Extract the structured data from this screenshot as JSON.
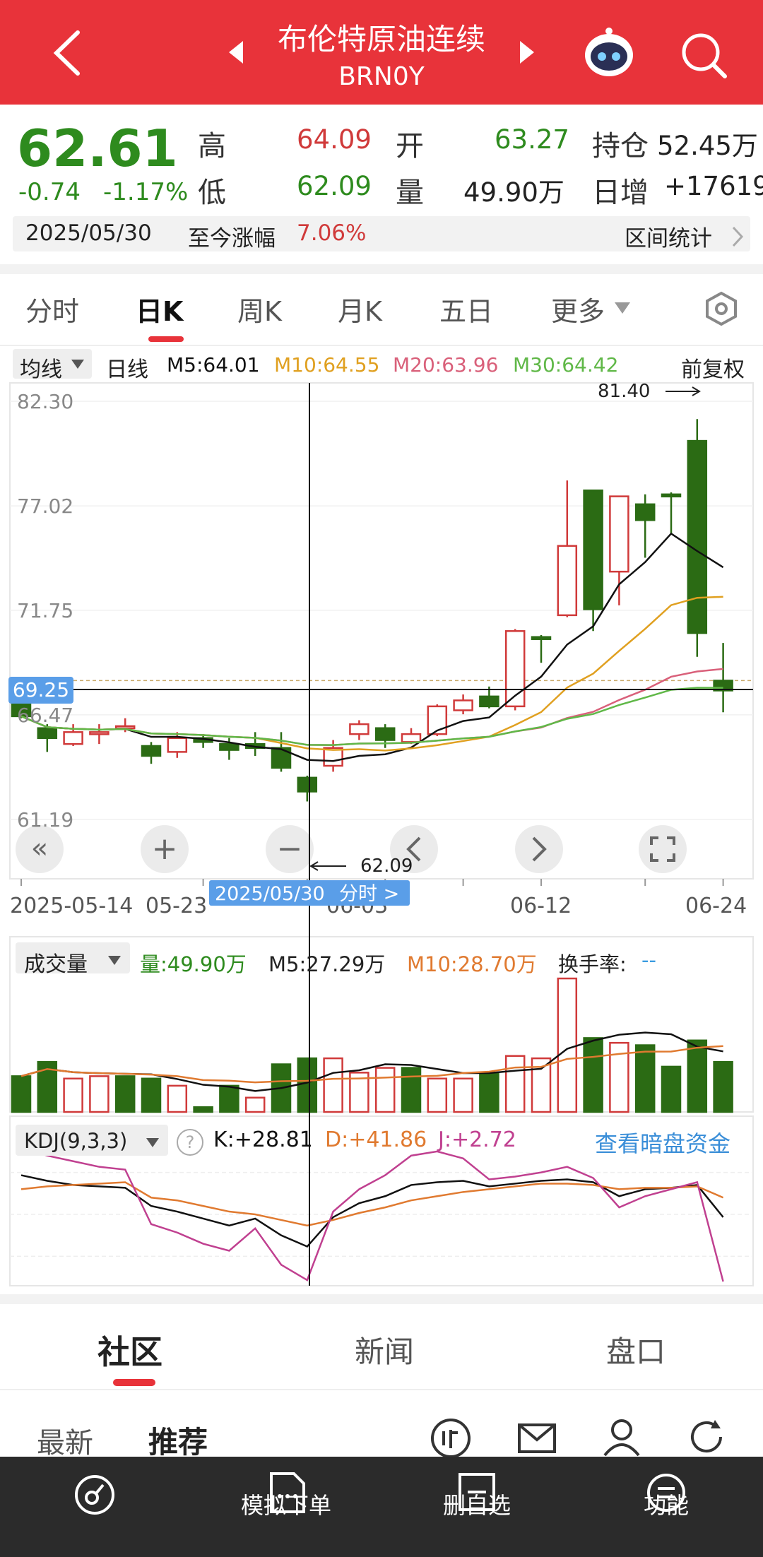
{
  "header": {
    "title": "布伦特原油连续",
    "code": "BRN0Y"
  },
  "quote": {
    "price": "62.61",
    "change": "-0.74",
    "pct": "-1.17%",
    "high_lbl": "高",
    "high": "64.09",
    "low_lbl": "低",
    "low": "62.09",
    "open_lbl": "开",
    "open": "63.27",
    "vol_lbl": "量",
    "vol": "49.90万",
    "hold_lbl": "持仓",
    "hold": "52.45万",
    "daily_lbl": "日增",
    "daily": "+17619",
    "date": "2025/05/30",
    "since_lbl": "至今涨幅",
    "since": "7.06%",
    "range_btn": "区间统计"
  },
  "tabs": [
    "分时",
    "日K",
    "周K",
    "月K",
    "五日",
    "更多"
  ],
  "ma_bar": {
    "type": "均线",
    "period": "日线",
    "m5": "M5:64.01",
    "m10": "M10:64.55",
    "m20": "M20:63.96",
    "m30": "M30:64.42",
    "adj": "前复权"
  },
  "colors": {
    "up": "#d03a3a",
    "down": "#2b6b14",
    "m5": "#111111",
    "m10": "#e0a020",
    "m20": "#d9607a",
    "m30": "#60b848"
  },
  "price_axis": [
    "82.30",
    "77.02",
    "71.75",
    "69.25",
    "66.47",
    "61.19"
  ],
  "date_axis": [
    "2025-05-14",
    "05-23",
    "06-03",
    "06-12",
    "06-24"
  ],
  "annotations": {
    "high": "81.40",
    "low": "62.09",
    "crosshair_date": "2025/05/30",
    "crosshair_btn": "分时 >"
  },
  "volume_bar": {
    "name": "成交量",
    "vol": "量:49.90万",
    "m5": "M5:27.29万",
    "m10": "M10:28.70万",
    "turnover": "换手率:",
    "turnover_val": "--"
  },
  "kdj_bar": {
    "name": "KDJ(9,3,3)",
    "help": "?",
    "k": "K:+28.81",
    "d": "D:+41.86",
    "j": "J:+2.72",
    "link": "查看暗盘资金"
  },
  "bottom_tabs": [
    "社区",
    "新闻",
    "盘口"
  ],
  "sub_tabs": [
    "最新",
    "推荐"
  ],
  "nav": [
    "模拟下单",
    "删自选",
    "功能"
  ],
  "chart_data": {
    "type": "candlestick",
    "ylim": [
      61.19,
      82.3
    ],
    "candles": [
      {
        "o": 67.0,
        "c": 66.4,
        "h": 67.2,
        "l": 66.3
      },
      {
        "o": 65.8,
        "c": 65.3,
        "h": 66.0,
        "l": 64.6
      },
      {
        "o": 65.0,
        "c": 65.6,
        "h": 66.0,
        "l": 64.9
      },
      {
        "o": 65.6,
        "c": 65.6,
        "h": 66.0,
        "l": 65.0
      },
      {
        "o": 65.9,
        "c": 65.9,
        "h": 66.3,
        "l": 65.6
      },
      {
        "o": 64.9,
        "c": 64.4,
        "h": 65.1,
        "l": 64.0
      },
      {
        "o": 64.6,
        "c": 65.3,
        "h": 65.6,
        "l": 64.3
      },
      {
        "o": 65.3,
        "c": 65.1,
        "h": 65.5,
        "l": 64.8
      },
      {
        "o": 65.0,
        "c": 64.7,
        "h": 65.3,
        "l": 64.2
      },
      {
        "o": 65.0,
        "c": 64.8,
        "h": 65.6,
        "l": 64.4
      },
      {
        "o": 64.8,
        "c": 63.8,
        "h": 65.6,
        "l": 63.6
      },
      {
        "o": 63.3,
        "c": 62.6,
        "h": 63.4,
        "l": 62.1
      },
      {
        "o": 63.9,
        "c": 64.8,
        "h": 65.2,
        "l": 63.6
      },
      {
        "o": 65.5,
        "c": 66.0,
        "h": 66.2,
        "l": 65.2
      },
      {
        "o": 65.8,
        "c": 65.2,
        "h": 66.0,
        "l": 64.8
      },
      {
        "o": 65.1,
        "c": 65.5,
        "h": 65.8,
        "l": 65.0
      },
      {
        "o": 65.5,
        "c": 66.9,
        "h": 67.0,
        "l": 65.4
      },
      {
        "o": 66.7,
        "c": 67.2,
        "h": 67.5,
        "l": 66.5
      },
      {
        "o": 67.4,
        "c": 66.9,
        "h": 67.9,
        "l": 66.8
      },
      {
        "o": 66.9,
        "c": 70.7,
        "h": 70.8,
        "l": 66.7
      },
      {
        "o": 70.4,
        "c": 70.3,
        "h": 70.5,
        "l": 69.1
      },
      {
        "o": 71.5,
        "c": 75.0,
        "h": 78.3,
        "l": 71.4
      },
      {
        "o": 77.8,
        "c": 71.8,
        "h": 77.8,
        "l": 70.7
      },
      {
        "o": 73.7,
        "c": 77.5,
        "h": 77.5,
        "l": 72.0
      },
      {
        "o": 77.1,
        "c": 76.3,
        "h": 77.6,
        "l": 74.4
      },
      {
        "o": 77.6,
        "c": 77.5,
        "h": 77.7,
        "l": 75.6
      },
      {
        "o": 80.3,
        "c": 70.6,
        "h": 81.4,
        "l": 69.4
      },
      {
        "o": 68.2,
        "c": 67.7,
        "h": 70.1,
        "l": 66.6
      }
    ],
    "volume": [
      {
        "v": 30,
        "u": false
      },
      {
        "v": 42,
        "u": false
      },
      {
        "v": 28,
        "u": true
      },
      {
        "v": 30,
        "u": true
      },
      {
        "v": 30,
        "u": false
      },
      {
        "v": 28,
        "u": false
      },
      {
        "v": 22,
        "u": true
      },
      {
        "v": 4,
        "u": false
      },
      {
        "v": 22,
        "u": false
      },
      {
        "v": 12,
        "u": true
      },
      {
        "v": 40,
        "u": false
      },
      {
        "v": 45,
        "u": false
      },
      {
        "v": 45,
        "u": true
      },
      {
        "v": 33,
        "u": true
      },
      {
        "v": 37,
        "u": true
      },
      {
        "v": 37,
        "u": false
      },
      {
        "v": 28,
        "u": true
      },
      {
        "v": 28,
        "u": true
      },
      {
        "v": 33,
        "u": false
      },
      {
        "v": 47,
        "u": true
      },
      {
        "v": 45,
        "u": true
      },
      {
        "v": 112,
        "u": true
      },
      {
        "v": 62,
        "u": false
      },
      {
        "v": 58,
        "u": true
      },
      {
        "v": 56,
        "u": false
      },
      {
        "v": 38,
        "u": false
      },
      {
        "v": 60,
        "u": false
      },
      {
        "v": 42,
        "u": false
      }
    ],
    "kdj": {
      "k": [
        78,
        74,
        71,
        70,
        69,
        56,
        52,
        47,
        42,
        47,
        35,
        27,
        48,
        58,
        63,
        71,
        73,
        74,
        70,
        72,
        74,
        75,
        73,
        63,
        68,
        69,
        71,
        48
      ],
      "d": [
        68,
        70,
        71,
        72,
        73,
        62,
        60,
        56,
        52,
        50,
        46,
        42,
        46,
        51,
        55,
        60,
        63,
        66,
        68,
        70,
        72,
        72,
        71,
        68,
        69,
        69,
        70,
        62
      ],
      "j": [
        98,
        92,
        88,
        84,
        82,
        43,
        37,
        29,
        24,
        40,
        14,
        3,
        52,
        68,
        78,
        92,
        95,
        90,
        75,
        77,
        80,
        84,
        76,
        55,
        63,
        68,
        73,
        2
      ]
    }
  }
}
